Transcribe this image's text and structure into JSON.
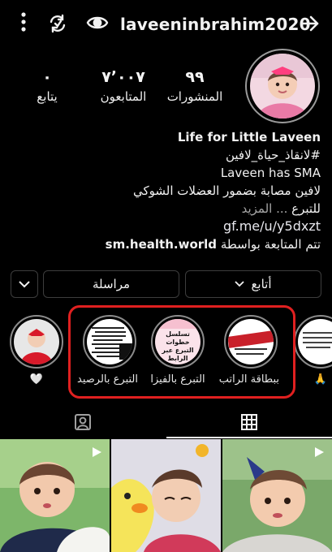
{
  "header": {
    "username": "laveeninbrahim2020",
    "icons": [
      "more-icon",
      "refresh-icon",
      "eye-icon",
      "arrow-right-icon"
    ]
  },
  "stats": {
    "posts": {
      "count": "٩٩",
      "label": "المنشورات"
    },
    "followers": {
      "count": "٧٬٠٠٧",
      "label": "المتابعون"
    },
    "following": {
      "count": "٠",
      "label": "يتابع"
    }
  },
  "bio": {
    "name": "Life for Little Laveen",
    "hashtag": "#لانقاذ_حياة_لافين",
    "line1": "Laveen has SMA",
    "line2": "لافين مصابة بضمور العضلات الشوكي",
    "line3_text": "للتبرع",
    "line3_more": "... المزيد",
    "link": "gf.me/u/y5dxzt",
    "managed_prefix": "تتم المتابعة بواسطة",
    "managed_by": "sm.health.world"
  },
  "buttons": {
    "follow": "أتابع",
    "message": "مراسلة"
  },
  "highlights": [
    {
      "label": "",
      "icon": "heart-icon"
    },
    {
      "label": "التبرع بالرصيد"
    },
    {
      "label": "التبرع بالفيزا",
      "thumb_text": "تسلسل خطوات التبرع عبر الرابط الموجود بالبايو"
    },
    {
      "label": "ببطاقة الراتب"
    },
    {
      "label": "",
      "icon": "pray-icon"
    }
  ],
  "tabs": [
    "tagged-tab",
    "grid-tab"
  ],
  "colors": {
    "background": "#000000",
    "annotation_red": "#e02020",
    "border_gray": "#3d3d3d",
    "muted_text": "#a8a8a8"
  }
}
